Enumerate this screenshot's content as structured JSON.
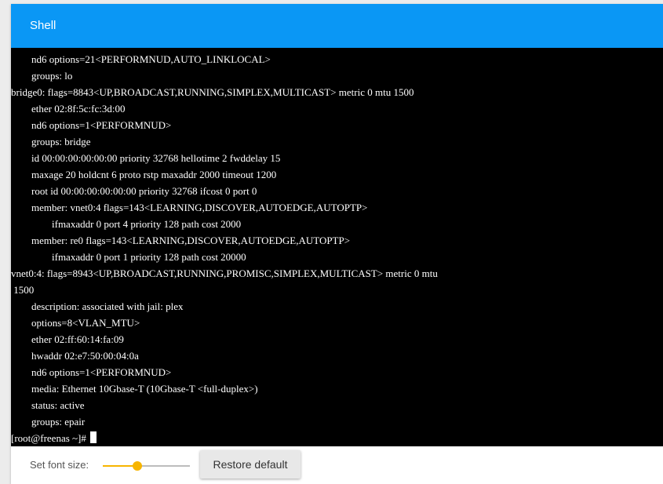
{
  "header": {
    "title": "Shell"
  },
  "terminal": {
    "lines": [
      "        nd6 options=21<PERFORMNUD,AUTO_LINKLOCAL>",
      "        groups: lo",
      "bridge0: flags=8843<UP,BROADCAST,RUNNING,SIMPLEX,MULTICAST> metric 0 mtu 1500",
      "        ether 02:8f:5c:fc:3d:00",
      "        nd6 options=1<PERFORMNUD>",
      "        groups: bridge",
      "        id 00:00:00:00:00:00 priority 32768 hellotime 2 fwddelay 15",
      "        maxage 20 holdcnt 6 proto rstp maxaddr 2000 timeout 1200",
      "        root id 00:00:00:00:00:00 priority 32768 ifcost 0 port 0",
      "        member: vnet0:4 flags=143<LEARNING,DISCOVER,AUTOEDGE,AUTOPTP>",
      "                ifmaxaddr 0 port 4 priority 128 path cost 2000",
      "        member: re0 flags=143<LEARNING,DISCOVER,AUTOEDGE,AUTOPTP>",
      "                ifmaxaddr 0 port 1 priority 128 path cost 20000",
      "vnet0:4: flags=8943<UP,BROADCAST,RUNNING,PROMISC,SIMPLEX,MULTICAST> metric 0 mtu",
      " 1500",
      "        description: associated with jail: plex",
      "        options=8<VLAN_MTU>",
      "        ether 02:ff:60:14:fa:09",
      "        hwaddr 02:e7:50:00:04:0a",
      "        nd6 options=1<PERFORMNUD>",
      "        media: Ethernet 10Gbase-T (10Gbase-T <full-duplex>)",
      "        status: active",
      "        groups: epair"
    ],
    "prompt": "[root@freenas ~]# "
  },
  "footer": {
    "font_size_label": "Set font size:",
    "font_slider_level": 0.4,
    "restore_label": "Restore default"
  },
  "colors": {
    "toolbar": "#0a97f5",
    "terminal_bg": "#000000",
    "terminal_fg": "#ffffff",
    "slider_accent": "#f7b500"
  }
}
